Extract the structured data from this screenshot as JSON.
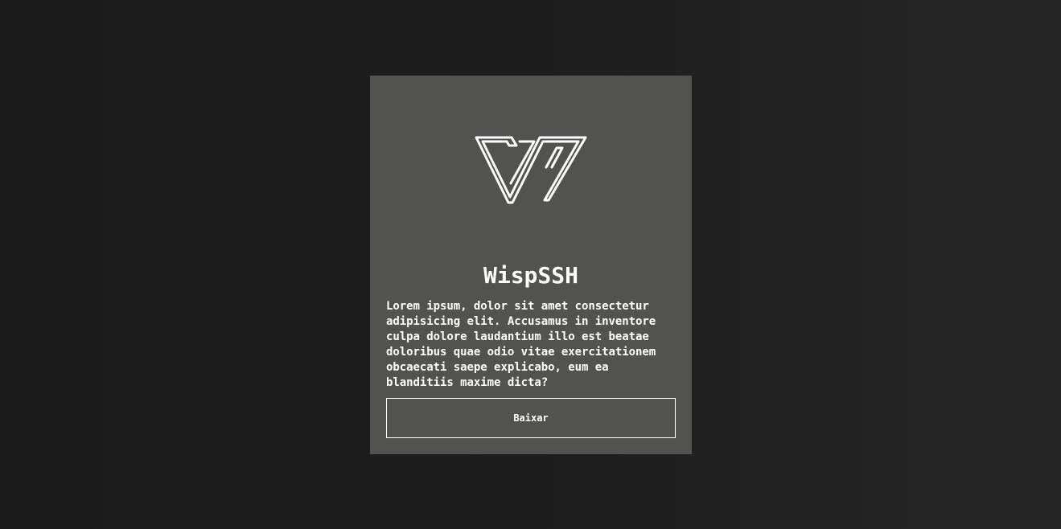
{
  "card": {
    "logo_icon": "w-logo-icon",
    "title": "WispSSH",
    "description": "Lorem ipsum, dolor sit amet consectetur adipisicing elit. Accusamus in inventore culpa dolore laudantium illo est beatae doloribus quae odio vitae exercitationem obcaecati saepe explicabo, eum ea blanditiis maxime dicta?",
    "download_label": "Baixar"
  },
  "colors": {
    "background": "#1c1c1c",
    "card": "#525250",
    "text": "#ffffff"
  }
}
